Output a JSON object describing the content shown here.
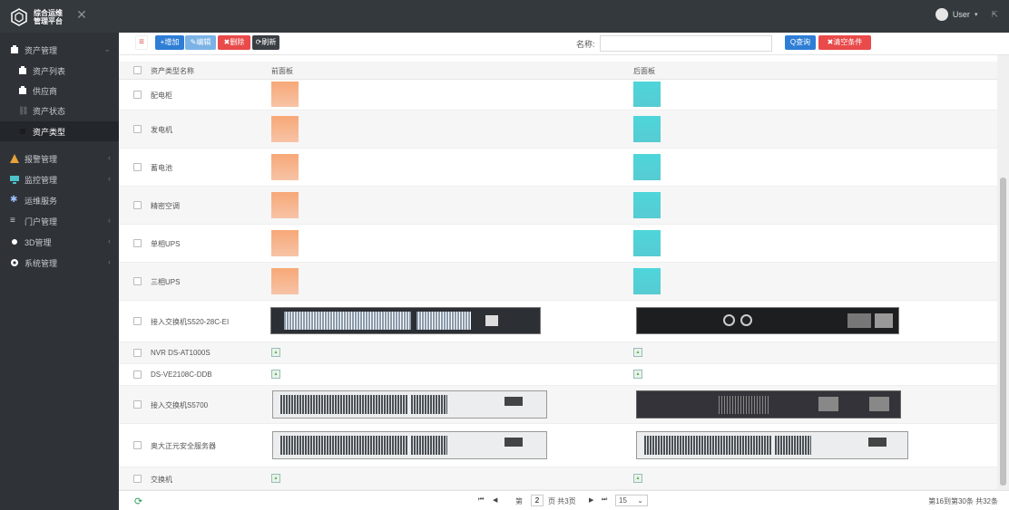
{
  "header": {
    "brand_line1": "综合运维",
    "brand_line2": "管理平台",
    "user_label": "User",
    "user_caret": "▾"
  },
  "sidebar": {
    "items": [
      {
        "label": "资产管理",
        "icon": "building-icon",
        "arrow": "⌄"
      },
      {
        "label": "资产列表",
        "icon": "building-icon"
      },
      {
        "label": "供应商",
        "icon": "building-icon"
      },
      {
        "label": "资产状态",
        "icon": "link-icon"
      },
      {
        "label": "资产类型",
        "icon": "square-icon"
      },
      {
        "label": "报警管理",
        "icon": "warning-icon",
        "arrow": "‹"
      },
      {
        "label": "监控管理",
        "icon": "monitor-icon",
        "arrow": "‹"
      },
      {
        "label": "运维服务",
        "icon": "gear-icon"
      },
      {
        "label": "门户管理",
        "icon": "menu-icon",
        "arrow": "‹"
      },
      {
        "label": "3D管理",
        "icon": "dot-icon",
        "arrow": "‹"
      },
      {
        "label": "系统管理",
        "icon": "cog-icon",
        "arrow": "‹"
      }
    ]
  },
  "toolbar": {
    "collapse_label": "≡",
    "add_label": "+增加",
    "edit_label": "✎编辑",
    "delete_label": "✖删除",
    "refresh_label": "⟳刷新",
    "search_label": "名称:",
    "search_value": "",
    "search_button": "Q查询",
    "reset_button": "✖清空条件"
  },
  "table": {
    "columns": [
      "资产类型名称",
      "前面板",
      "后面板"
    ],
    "rows": [
      {
        "name": "配电柜",
        "front": "orange",
        "back": "cyan"
      },
      {
        "name": "发电机",
        "front": "orange",
        "back": "cyan"
      },
      {
        "name": "蓄电池",
        "front": "orange",
        "back": "cyan"
      },
      {
        "name": "精密空调",
        "front": "orange",
        "back": "cyan"
      },
      {
        "name": "单相UPS",
        "front": "orange",
        "back": "cyan"
      },
      {
        "name": "三相UPS",
        "front": "orange",
        "back": "cyan"
      },
      {
        "name": "接入交换机S520-28C-EI",
        "front": "switch-dark",
        "back": "switch-dark-back"
      },
      {
        "name": "NVR DS-AT1000S",
        "front": "broken",
        "back": "broken"
      },
      {
        "name": "DS-VE2108C-DDB",
        "front": "broken",
        "back": "broken"
      },
      {
        "name": "接入交换机S5700",
        "front": "switch-light",
        "back": "switch-purple"
      },
      {
        "name": "奥大正元安全服务器",
        "front": "switch-light",
        "back": "switch-light"
      },
      {
        "name": "交换机",
        "front": "broken",
        "back": "broken"
      }
    ]
  },
  "pager": {
    "refresh_icon": "⟳",
    "first": "⏮",
    "prev": "◀",
    "page_prefix": "第",
    "page": "2",
    "page_suffix": "页 共3页",
    "next": "▶",
    "last": "⏭",
    "page_size": "15",
    "page_size_caret": "⌄",
    "info": "第16到第30条  共32条"
  },
  "colors": {
    "topbar": "#34393d",
    "sidebar": "#2f3338",
    "primary": "#2e7ed6",
    "danger": "#e94a4a",
    "panel_orange": "#f7a877",
    "panel_cyan": "#4dd6da"
  }
}
